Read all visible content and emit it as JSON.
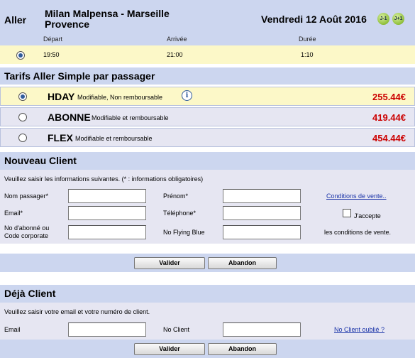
{
  "header": {
    "direction": "Aller",
    "route_line1": "Milan Malpensa - Marseille",
    "route_line2": "Provence",
    "date": "Vendredi 12 Août 2016",
    "prev_day": "J-1",
    "next_day": "J+1"
  },
  "columns": {
    "departure": "Départ",
    "arrival": "Arrivée",
    "duration": "Durée"
  },
  "flight": {
    "departure": "19:50",
    "arrival": "21:00",
    "duration": "1:10"
  },
  "fares": {
    "title": "Tarifs Aller Simple par passager",
    "items": [
      {
        "code": "HDAY",
        "desc": "Modifiable, Non remboursable",
        "price": "255.44€",
        "selected": true,
        "info_icon": "i"
      },
      {
        "code": "ABONNE",
        "desc": "Modifiable et remboursable",
        "price": "419.44€",
        "selected": false
      },
      {
        "code": "FLEX",
        "desc": "Modifiable et remboursable",
        "price": "454.44€",
        "selected": false
      }
    ]
  },
  "new_client": {
    "title": "Nouveau Client",
    "instructions": "Veuillez saisir les informations suivantes. (* : informations obligatoires)",
    "passenger_name_label": "Nom passager*",
    "first_name_label": "Prénom*",
    "terms_link": "Conditions de vente..",
    "email_label": "Email*",
    "phone_label": "Téléphone*",
    "accept_label": "J'accepte",
    "subscriber_label_1": "No d'abonné ou",
    "subscriber_label_2": "Code corporate",
    "flying_blue_label": "No Flying Blue",
    "terms_text": "les conditions de vente.",
    "validate_label": "Valider",
    "cancel_label": "Abandon"
  },
  "existing_client": {
    "title": "Déjà Client",
    "instructions": "Veuillez saisir votre email et votre numéro de client.",
    "email_label": "Email",
    "client_no_label": "No Client",
    "forgot_link": "No Client oublié ?",
    "validate_label": "Valider",
    "cancel_label": "Abandon"
  },
  "colors": {
    "panel": "#ccd6ef",
    "highlight": "#fcf8c8",
    "price": "#cc0000",
    "link": "#1a33a8"
  }
}
